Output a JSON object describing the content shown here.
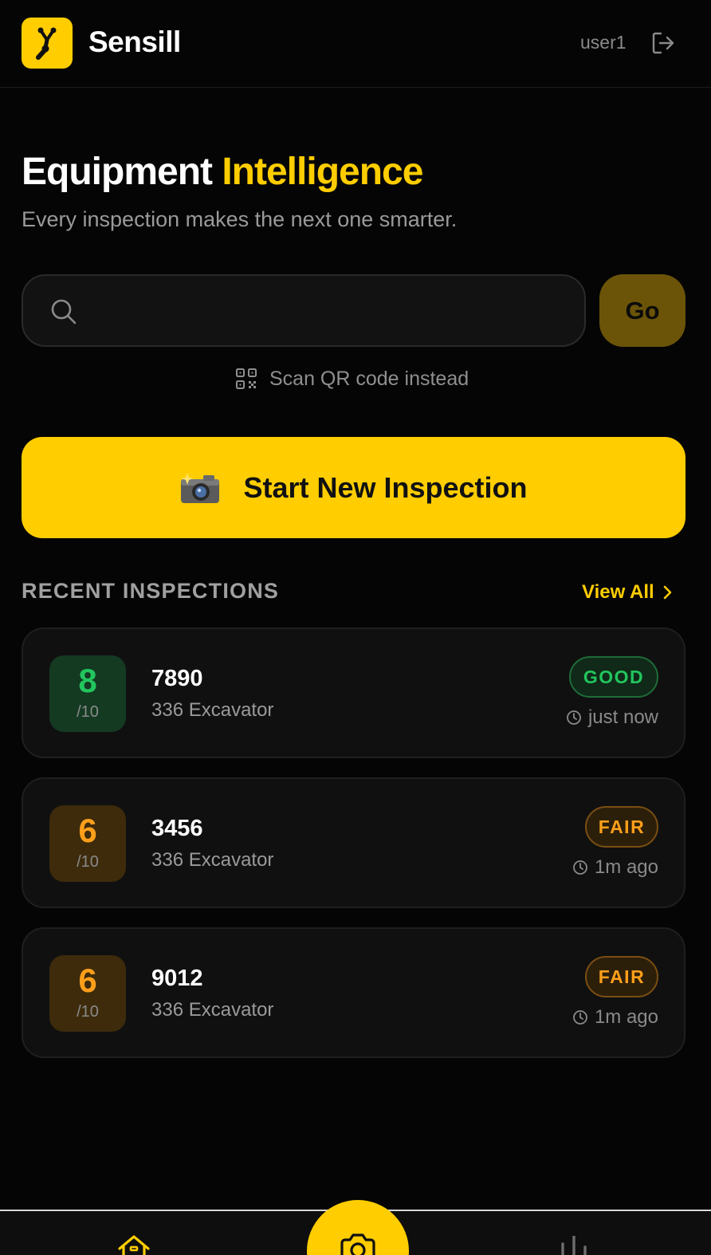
{
  "app": {
    "brand": "Sensill",
    "username": "user1",
    "accent_color": "#FFCD00"
  },
  "hero": {
    "title_main": "Equipment",
    "title_accent": "Intelligence",
    "subtitle": "Every inspection makes the next one smarter."
  },
  "search": {
    "value": "",
    "go_label": "Go",
    "scan_label": "Scan QR code instead"
  },
  "cta": {
    "emoji": "📸",
    "label": "Start New Inspection"
  },
  "recent": {
    "title": "RECENT INSPECTIONS",
    "view_all_label": "View All",
    "items": [
      {
        "score": "8",
        "score_max": "/10",
        "id": "7890",
        "model": "336 Excavator",
        "status": "GOOD",
        "status_color": "#22c55e",
        "time": "just now"
      },
      {
        "score": "6",
        "score_max": "/10",
        "id": "3456",
        "model": "336 Excavator",
        "status": "FAIR",
        "status_color": "#ff9f1a",
        "time": "1m ago"
      },
      {
        "score": "6",
        "score_max": "/10",
        "id": "9012",
        "model": "336 Excavator",
        "status": "FAIR",
        "status_color": "#ff9f1a",
        "time": "1m ago"
      }
    ]
  },
  "nav": {
    "icons": [
      "home-icon",
      "camera-icon",
      "stats-icon"
    ]
  }
}
